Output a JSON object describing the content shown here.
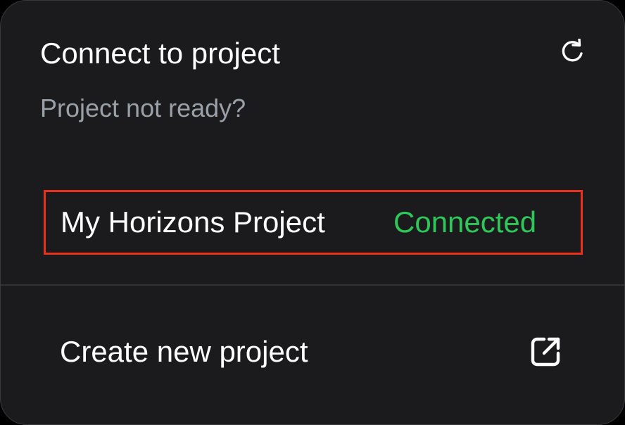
{
  "header": {
    "title": "Connect to project",
    "subtitle": "Project not ready?",
    "refresh_icon": "refresh-icon"
  },
  "project": {
    "name": "My Horizons Project",
    "status": "Connected",
    "status_color": "#2fc75a",
    "highlight_color": "#e8321e"
  },
  "create": {
    "label": "Create new project",
    "icon": "external-link-icon"
  },
  "colors": {
    "background": "#1b1b1d",
    "subtitle": "#9aa0a8"
  }
}
